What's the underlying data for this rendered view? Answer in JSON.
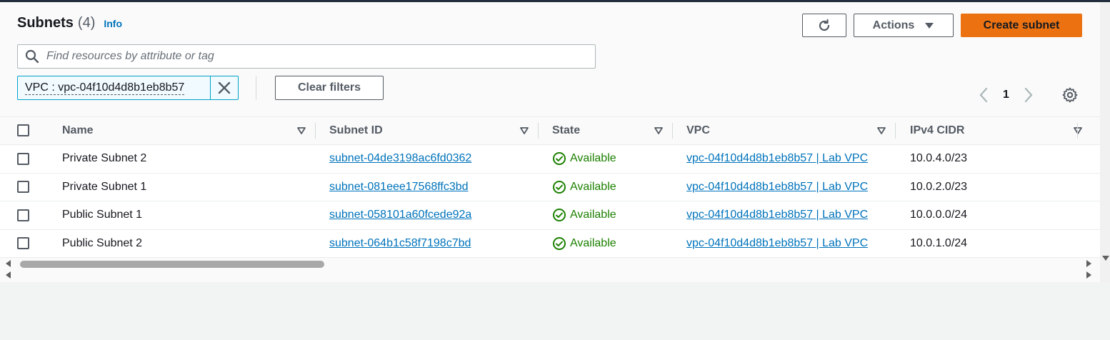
{
  "header": {
    "title": "Subnets",
    "count": "(4)",
    "info_label": "Info"
  },
  "toolbar": {
    "refresh_icon": "refresh-icon",
    "actions_label": "Actions",
    "create_label": "Create subnet"
  },
  "search": {
    "placeholder": "Find resources by attribute or tag"
  },
  "filter": {
    "token_label": "VPC : vpc-04f10d4d8b1eb8b57",
    "clear_label": "Clear filters"
  },
  "pagination": {
    "current_page": "1"
  },
  "table": {
    "columns": [
      "Name",
      "Subnet ID",
      "State",
      "VPC",
      "IPv4 CIDR"
    ],
    "rows": [
      {
        "name": "Private Subnet 2",
        "subnet_id": "subnet-04de3198ac6fd0362",
        "state": "Available",
        "vpc": "vpc-04f10d4d8b1eb8b57 | Lab VPC",
        "cidr": "10.0.4.0/23"
      },
      {
        "name": "Private Subnet 1",
        "subnet_id": "subnet-081eee17568ffc3bd",
        "state": "Available",
        "vpc": "vpc-04f10d4d8b1eb8b57 | Lab VPC",
        "cidr": "10.0.2.0/23"
      },
      {
        "name": "Public Subnet 1",
        "subnet_id": "subnet-058101a60fcede92a",
        "state": "Available",
        "vpc": "vpc-04f10d4d8b1eb8b57 | Lab VPC",
        "cidr": "10.0.0.0/24"
      },
      {
        "name": "Public Subnet 2",
        "subnet_id": "subnet-064b1c58f7198c7bd",
        "state": "Available",
        "vpc": "vpc-04f10d4d8b1eb8b57 | Lab VPC",
        "cidr": "10.0.1.0/24"
      }
    ]
  },
  "colors": {
    "primary": "#ec7211",
    "link": "#0073bb",
    "success": "#1d8102"
  }
}
